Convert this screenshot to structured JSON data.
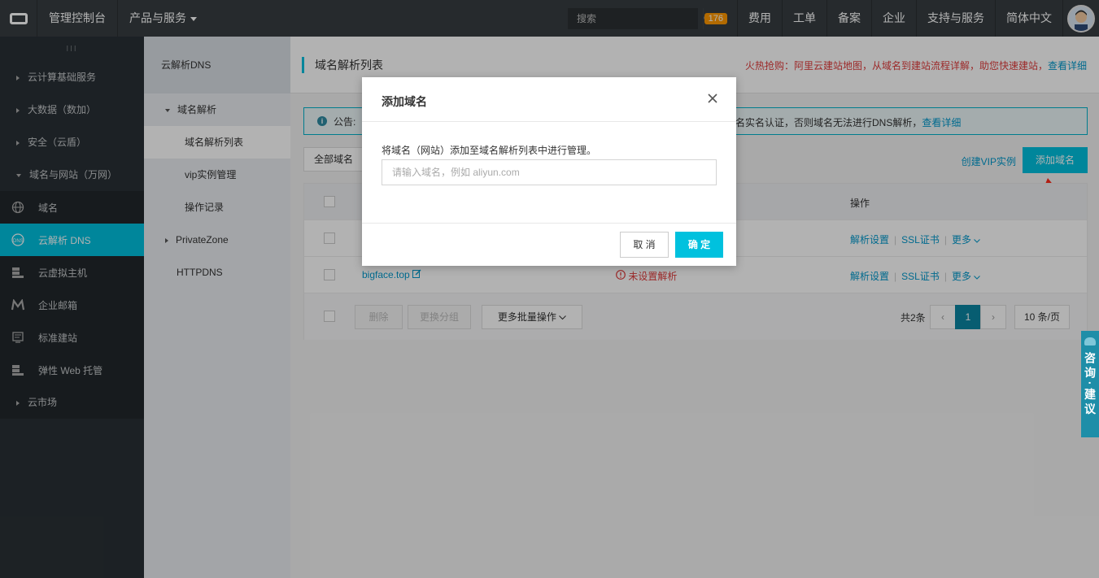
{
  "topbar": {
    "console": "管理控制台",
    "products": "产品与服务",
    "search_placeholder": "搜索",
    "notification_count": "176",
    "items": [
      "费用",
      "工单",
      "备案",
      "企业",
      "支持与服务",
      "简体中文"
    ]
  },
  "sidebar": {
    "handle": "III",
    "groups": {
      "cloud": "云计算基础服务",
      "bigdata": "大数据（数加）",
      "security": "安全（云盾）",
      "domain": "域名与网站（万网）",
      "market": "云市场"
    },
    "items": [
      "域名",
      "云解析 DNS",
      "云虚拟主机",
      "企业邮箱",
      "标准建站",
      "弹性 Web 托管"
    ]
  },
  "subnav": {
    "title": "云解析DNS",
    "section": "域名解析",
    "children": [
      "域名解析列表",
      "vip实例管理",
      "操作记录"
    ],
    "private_zone": "PrivateZone",
    "httpdns": "HTTPDNS"
  },
  "main": {
    "title": "域名解析列表",
    "promo_text": "火热抢购：阿里云建站地图，从域名到建站流程详解，助您快速建站，",
    "promo_link": "查看详细",
    "notice_prefix": "公告:",
    "notice_tail": "名实名认证，否则域名无法进行DNS解析，",
    "notice_link": "查看详细",
    "filter": "全部域名",
    "vip_link": "创建VIP实例",
    "add_button": "添加域名",
    "col_op": "操作",
    "rows": [
      {
        "domain": "",
        "status": "",
        "a1": "解析设置",
        "a2": "SSL证书",
        "a3": "更多"
      },
      {
        "domain": "bigface.top",
        "status": "未设置解析",
        "a1": "解析设置",
        "a2": "SSL证书",
        "a3": "更多"
      }
    ],
    "footer": {
      "delete": "删除",
      "change_group": "更换分组",
      "more_batch": "更多批量操作",
      "total": "共2条",
      "page": "1",
      "per_page": "10 条/页"
    }
  },
  "modal": {
    "title": "添加域名",
    "description": "将域名（网站）添加至域名解析列表中进行管理。",
    "input_placeholder": "请输入域名，例如 aliyun.com",
    "cancel": "取 消",
    "confirm": "确 定"
  },
  "consult": {
    "text": "咨询·建议"
  },
  "colors": {
    "accent": "#00c1de",
    "topbar": "#373d41",
    "sidebar": "#293035",
    "link": "#0099cc",
    "alert": "#e03c3c"
  }
}
